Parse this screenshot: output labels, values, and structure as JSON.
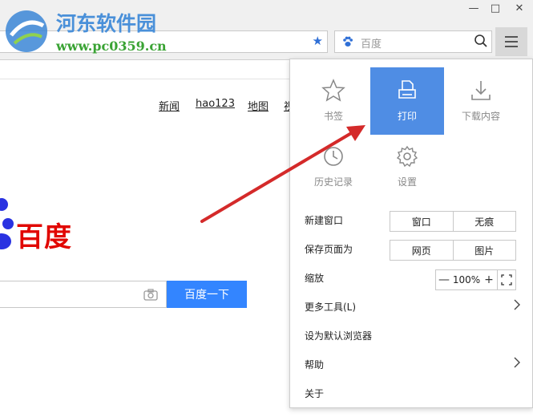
{
  "watermark": {
    "title": "河东软件园",
    "url": "www.pc0359.cn"
  },
  "window": {
    "minimize": "—",
    "maximize": "□",
    "close": "✕"
  },
  "search": {
    "placeholder": "百度"
  },
  "page": {
    "nav": [
      "新闻",
      "hao123",
      "地图",
      "视"
    ],
    "logo": "百度",
    "search_button": "百度一下"
  },
  "menu": {
    "tiles": [
      {
        "label": "书签",
        "icon": "star-icon"
      },
      {
        "label": "打印",
        "icon": "print-icon"
      },
      {
        "label": "下载内容",
        "icon": "download-icon"
      },
      {
        "label": "历史记录",
        "icon": "history-icon"
      },
      {
        "label": "设置",
        "icon": "gear-icon"
      }
    ],
    "new_window": {
      "label": "新建窗口",
      "options": [
        "窗口",
        "无痕"
      ]
    },
    "save_page": {
      "label": "保存页面为",
      "options": [
        "网页",
        "图片"
      ]
    },
    "zoom": {
      "label": "缩放",
      "minus": "—",
      "value": "100%",
      "plus": "+"
    },
    "more_tools": "更多工具(L)",
    "set_default": "设为默认浏览器",
    "help": "帮助",
    "about": "关于"
  },
  "colors": {
    "accent": "#4f8de4",
    "baidu_red": "#e10600",
    "baidu_blue": "#3385ff",
    "annotation_arrow": "#d42a2a"
  }
}
